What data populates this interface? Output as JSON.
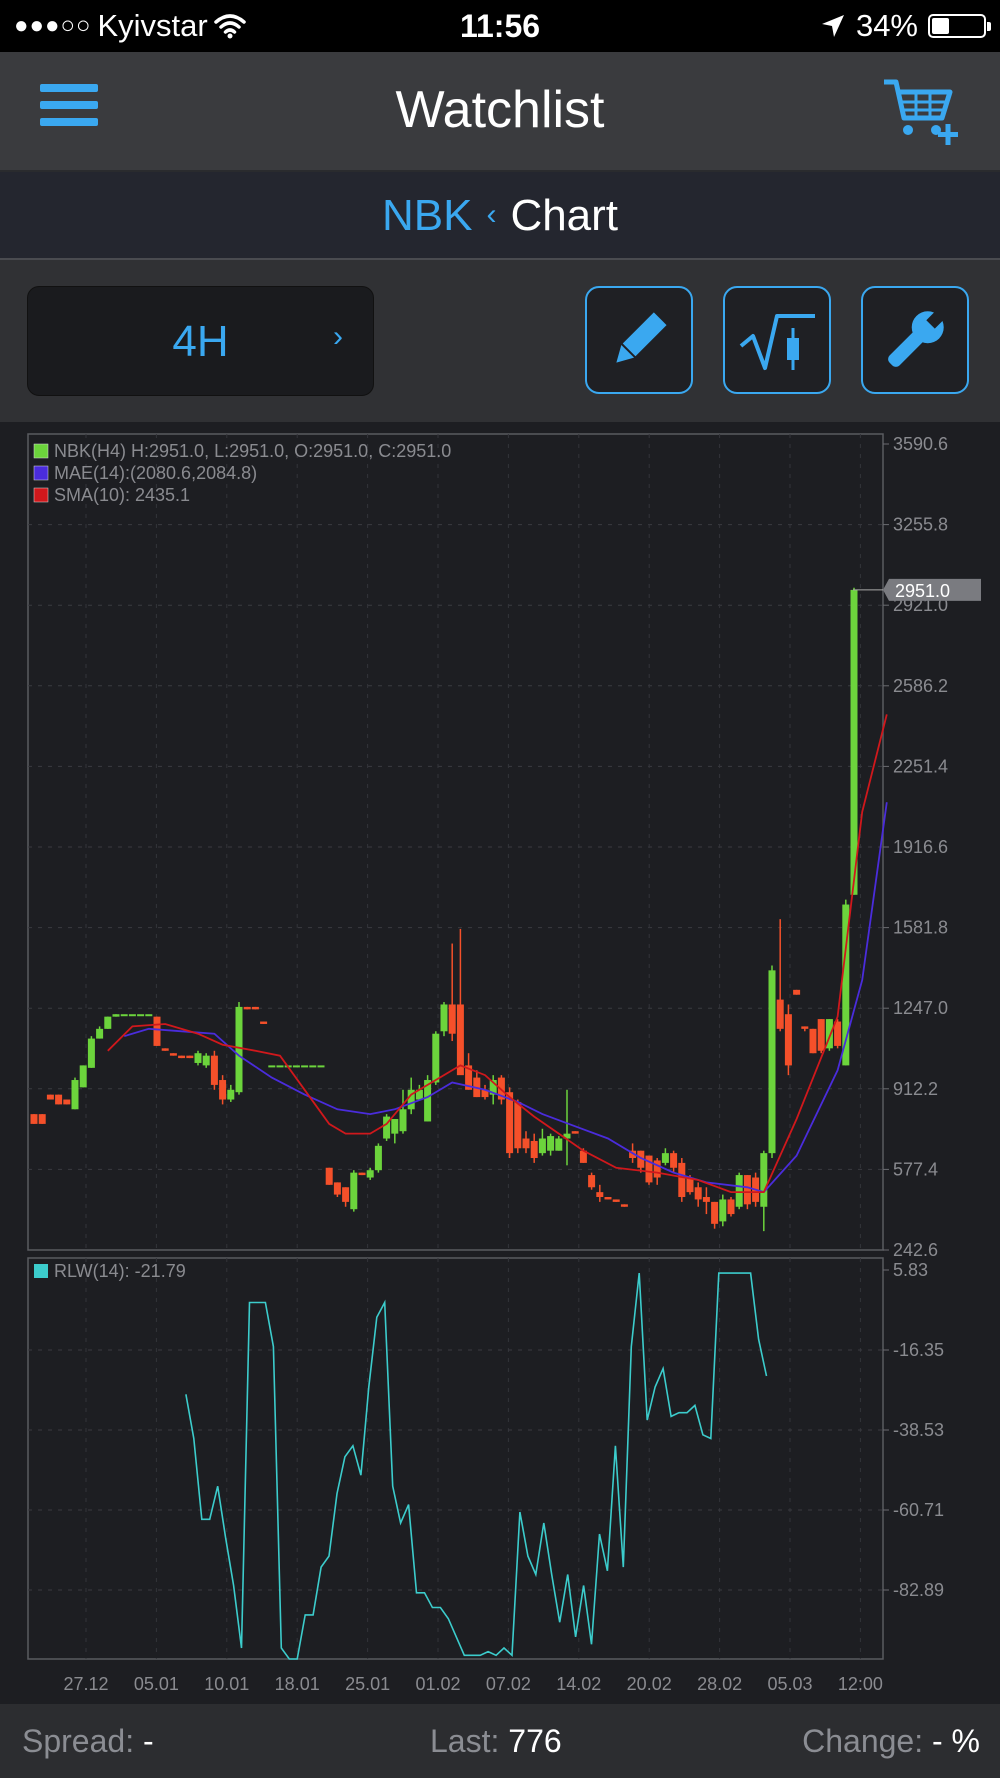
{
  "status_bar": {
    "carrier": "Kyivstar",
    "time": "11:56",
    "battery": "34%",
    "battery_level": 0.34,
    "icons": [
      "signal-dots-icon",
      "wifi-icon",
      "location-arrow-icon",
      "battery-icon"
    ]
  },
  "nav": {
    "title": "Watchlist",
    "left_icon": "hamburger-menu-icon",
    "right_icon": "cart-add-icon"
  },
  "breadcrumb": {
    "parent": "NBK",
    "separator": "‹",
    "current": "Chart"
  },
  "toolbar": {
    "period": "4H",
    "period_chevron": "›",
    "tools": [
      "pencil-icon",
      "indicator-icon",
      "wrench-icon"
    ]
  },
  "colors": {
    "accent": "#3aa8f0",
    "bull": "#6cd43c",
    "bear": "#f4502a",
    "sma": "#d0181c",
    "mae": "#4a2cdc",
    "rlw": "#3ccccc",
    "background": "#1d1e22"
  },
  "chart_data": [
    {
      "type": "candlestick",
      "title": "",
      "legend": [
        {
          "name": "NBK(H4)",
          "text": "NBK(H4) H:2951.0, L:2951.0, O:2951.0, C:2951.0",
          "color": "#6cd43c"
        },
        {
          "name": "MAE(14)",
          "text": "MAE(14):(2080.6,2084.8)",
          "color": "#4a2cdc"
        },
        {
          "name": "SMA(10)",
          "text": "SMA(10): 2435.1",
          "color": "#d0181c"
        }
      ],
      "legend_position": "top-left",
      "y_ticks": [
        "3590.6",
        "3255.8",
        "2921.0",
        "2586.2",
        "2251.4",
        "1916.6",
        "1581.8",
        "1247.0",
        "912.2",
        "577.4",
        "242.6"
      ],
      "ylim": [
        242.6,
        3590.6
      ],
      "last_price_label": "2951.0",
      "last_price": 2951.0,
      "x_ticks": [
        "27.12",
        "05.01",
        "10.01",
        "18.01",
        "25.01",
        "01.02",
        "07.02",
        "14.02",
        "20.02",
        "28.02",
        "05.03",
        "12:00"
      ],
      "grid": true,
      "candles": [
        [
          0,
          800,
          760,
          800,
          760
        ],
        [
          1,
          800,
          760,
          800,
          760
        ],
        [
          2,
          880,
          860,
          880,
          860
        ],
        [
          3,
          880,
          840,
          880,
          840
        ],
        [
          4,
          860,
          840,
          860,
          840
        ],
        [
          5,
          950,
          820,
          820,
          940
        ],
        [
          6,
          1000,
          910,
          910,
          1000
        ],
        [
          7,
          1120,
          990,
          990,
          1110
        ],
        [
          8,
          1160,
          1110,
          1110,
          1150
        ],
        [
          9,
          1200,
          1150,
          1150,
          1200
        ],
        [
          10,
          1210,
          1200,
          1200,
          1210
        ],
        [
          11,
          1210,
          1210,
          1210,
          1210
        ],
        [
          12,
          1210,
          1210,
          1210,
          1210
        ],
        [
          13,
          1210,
          1210,
          1210,
          1210
        ],
        [
          14,
          1210,
          1210,
          1210,
          1210
        ],
        [
          15,
          1200,
          1080,
          1200,
          1080
        ],
        [
          16,
          1070,
          1060,
          1070,
          1060
        ],
        [
          17,
          1050,
          1040,
          1050,
          1040
        ],
        [
          18,
          1040,
          1030,
          1040,
          1030
        ],
        [
          19,
          1040,
          1030,
          1040,
          1030
        ],
        [
          20,
          1060,
          1000,
          1010,
          1050
        ],
        [
          21,
          1050,
          990,
          1000,
          1040
        ],
        [
          22,
          1060,
          900,
          1040,
          920
        ],
        [
          23,
          960,
          840,
          940,
          860
        ],
        [
          24,
          920,
          850,
          860,
          900
        ],
        [
          25,
          1260,
          880,
          890,
          1240
        ],
        [
          26,
          1240,
          1230,
          1240,
          1230
        ],
        [
          27,
          1240,
          1230,
          1240,
          1230
        ],
        [
          28,
          1180,
          1170,
          1180,
          1170
        ],
        [
          29,
          1000,
          1000,
          1000,
          1000
        ],
        [
          30,
          1000,
          1000,
          1000,
          1000
        ],
        [
          31,
          1000,
          1000,
          1000,
          1000
        ],
        [
          32,
          1000,
          1000,
          1000,
          1000
        ],
        [
          33,
          1000,
          1000,
          1000,
          1000
        ],
        [
          34,
          1000,
          1000,
          1000,
          1000
        ],
        [
          35,
          1000,
          1000,
          1000,
          1000
        ],
        [
          36,
          580,
          510,
          580,
          510
        ],
        [
          37,
          520,
          460,
          520,
          470
        ],
        [
          38,
          500,
          420,
          500,
          440
        ],
        [
          39,
          570,
          400,
          410,
          560
        ],
        [
          40,
          560,
          550,
          560,
          550
        ],
        [
          41,
          580,
          530,
          540,
          570
        ],
        [
          42,
          680,
          560,
          570,
          670
        ],
        [
          43,
          800,
          690,
          700,
          790
        ],
        [
          44,
          780,
          680,
          720,
          780
        ],
        [
          45,
          900,
          720,
          730,
          820
        ],
        [
          46,
          950,
          800,
          820,
          900
        ],
        [
          47,
          920,
          860,
          860,
          900
        ],
        [
          48,
          960,
          770,
          770,
          940
        ],
        [
          49,
          1140,
          920,
          930,
          1130
        ],
        [
          50,
          1260,
          1120,
          1140,
          1250
        ],
        [
          51,
          1500,
          1100,
          1250,
          1130
        ],
        [
          52,
          1560,
          1100,
          1250,
          960
        ],
        [
          53,
          1050,
          900,
          1000,
          900
        ],
        [
          54,
          980,
          870,
          950,
          870
        ],
        [
          55,
          920,
          860,
          900,
          870
        ],
        [
          56,
          960,
          840,
          880,
          940
        ],
        [
          57,
          960,
          840,
          950,
          860
        ],
        [
          58,
          910,
          620,
          890,
          640
        ],
        [
          59,
          860,
          640,
          850,
          660
        ],
        [
          60,
          730,
          640,
          700,
          660
        ],
        [
          61,
          720,
          600,
          690,
          620
        ],
        [
          62,
          740,
          630,
          640,
          700
        ],
        [
          63,
          720,
          630,
          650,
          710
        ],
        [
          64,
          710,
          650,
          650,
          700
        ],
        [
          65,
          900,
          590,
          700,
          720
        ],
        [
          66,
          730,
          720,
          730,
          720
        ],
        [
          67,
          660,
          600,
          650,
          600
        ],
        [
          68,
          560,
          490,
          550,
          500
        ],
        [
          69,
          510,
          440,
          480,
          460
        ],
        [
          70,
          460,
          450,
          460,
          450
        ],
        [
          71,
          450,
          440,
          450,
          440
        ],
        [
          72,
          430,
          420,
          430,
          420
        ],
        [
          73,
          680,
          600,
          650,
          620
        ],
        [
          74,
          650,
          560,
          650,
          580
        ],
        [
          75,
          630,
          510,
          630,
          520
        ],
        [
          76,
          620,
          510,
          610,
          540
        ],
        [
          77,
          660,
          590,
          600,
          640
        ],
        [
          78,
          650,
          560,
          640,
          580
        ],
        [
          79,
          620,
          440,
          600,
          460
        ],
        [
          80,
          550,
          470,
          540,
          480
        ],
        [
          81,
          520,
          420,
          500,
          450
        ],
        [
          82,
          500,
          390,
          460,
          440
        ],
        [
          83,
          440,
          330,
          440,
          350
        ],
        [
          84,
          470,
          340,
          360,
          450
        ],
        [
          85,
          460,
          380,
          450,
          390
        ],
        [
          86,
          560,
          410,
          420,
          550
        ],
        [
          87,
          550,
          410,
          550,
          430
        ],
        [
          88,
          560,
          420,
          540,
          440
        ],
        [
          89,
          650,
          320,
          420,
          640
        ],
        [
          90,
          1410,
          620,
          640,
          1390
        ],
        [
          91,
          1600,
          1140,
          1270,
          1150
        ],
        [
          92,
          1250,
          960,
          1210,
          1000
        ],
        [
          93,
          1310,
          1290,
          1310,
          1290
        ],
        [
          94,
          1160,
          1140,
          1160,
          1150
        ],
        [
          95,
          1150,
          1050,
          1150,
          1050
        ],
        [
          96,
          1190,
          1050,
          1190,
          1060
        ],
        [
          97,
          1190,
          1060,
          1070,
          1190
        ],
        [
          98,
          1190,
          1070,
          1180,
          1080
        ],
        [
          99,
          1680,
          1000,
          1000,
          1660
        ],
        [
          100,
          2960,
          1700,
          1700,
          2951.0
        ]
      ],
      "sma_10": [
        [
          9,
          1060
        ],
        [
          12,
          1160
        ],
        [
          16,
          1170
        ],
        [
          20,
          1130
        ],
        [
          23,
          1085
        ],
        [
          27,
          1060
        ],
        [
          30,
          1040
        ],
        [
          33,
          900
        ],
        [
          36,
          760
        ],
        [
          38,
          720
        ],
        [
          41,
          720
        ],
        [
          43,
          760
        ],
        [
          46,
          880
        ],
        [
          49,
          940
        ],
        [
          52,
          1000
        ],
        [
          55,
          960
        ],
        [
          58,
          870
        ],
        [
          61,
          790
        ],
        [
          64,
          720
        ],
        [
          67,
          650
        ],
        [
          71,
          580
        ],
        [
          76,
          560
        ],
        [
          81,
          530
        ],
        [
          85,
          480
        ],
        [
          89,
          480
        ],
        [
          93,
          780
        ],
        [
          98,
          1200
        ],
        [
          101,
          2040
        ],
        [
          104,
          2440
        ]
      ],
      "mae_14": [
        [
          11,
          1120
        ],
        [
          14,
          1150
        ],
        [
          18,
          1140
        ],
        [
          22,
          1130
        ],
        [
          25,
          1040
        ],
        [
          29,
          950
        ],
        [
          33,
          880
        ],
        [
          37,
          820
        ],
        [
          41,
          800
        ],
        [
          44,
          820
        ],
        [
          48,
          870
        ],
        [
          51,
          930
        ],
        [
          55,
          900
        ],
        [
          59,
          850
        ],
        [
          62,
          800
        ],
        [
          66,
          750
        ],
        [
          70,
          700
        ],
        [
          74,
          620
        ],
        [
          78,
          560
        ],
        [
          82,
          520
        ],
        [
          87,
          500
        ],
        [
          89,
          480
        ],
        [
          93,
          630
        ],
        [
          98,
          980
        ],
        [
          101,
          1350
        ],
        [
          104,
          2080
        ]
      ]
    },
    {
      "type": "line",
      "title": "",
      "legend": [
        {
          "name": "RLW(14)",
          "text": "RLW(14): -21.79",
          "color": "#3ccccc"
        }
      ],
      "y_ticks": [
        "5.83",
        "-16.35",
        "-38.53",
        "-60.71",
        "-82.89"
      ],
      "ylim": [
        -100,
        5.83
      ],
      "grid": true,
      "series": [
        {
          "name": "RLW(14)",
          "values": [
            [
              16,
              -28
            ],
            [
              17,
              -40
            ],
            [
              18,
              -62
            ],
            [
              19,
              -62
            ],
            [
              20,
              -53
            ],
            [
              21,
              -67
            ],
            [
              22,
              -80
            ],
            [
              23,
              -97
            ],
            [
              24,
              -3
            ],
            [
              25,
              -3
            ],
            [
              26,
              -3
            ],
            [
              27,
              -15
            ],
            [
              28,
              -97
            ],
            [
              29,
              -100
            ],
            [
              30,
              -100
            ],
            [
              31,
              -88
            ],
            [
              32,
              -88
            ],
            [
              33,
              -75
            ],
            [
              34,
              -72
            ],
            [
              35,
              -55
            ],
            [
              36,
              -45
            ],
            [
              37,
              -42
            ],
            [
              38,
              -50
            ],
            [
              39,
              -26
            ],
            [
              40,
              -7
            ],
            [
              41,
              -3
            ],
            [
              42,
              -53
            ],
            [
              43,
              -63
            ],
            [
              44,
              -58
            ],
            [
              45,
              -82
            ],
            [
              46,
              -82
            ],
            [
              47,
              -86
            ],
            [
              48,
              -86
            ],
            [
              49,
              -89
            ],
            [
              50,
              -94
            ],
            [
              51,
              -99
            ],
            [
              52,
              -99
            ],
            [
              53,
              -99
            ],
            [
              54,
              -98
            ],
            [
              55,
              -99
            ],
            [
              56,
              -97
            ],
            [
              57,
              -99
            ],
            [
              58,
              -60
            ],
            [
              59,
              -72
            ],
            [
              60,
              -77
            ],
            [
              61,
              -63
            ],
            [
              62,
              -77
            ],
            [
              63,
              -90
            ],
            [
              64,
              -77
            ],
            [
              65,
              -94
            ],
            [
              66,
              -80
            ],
            [
              67,
              -96
            ],
            [
              68,
              -66
            ],
            [
              69,
              -76
            ],
            [
              70,
              -42
            ],
            [
              71,
              -75
            ],
            [
              72,
              -15
            ],
            [
              73,
              5
            ],
            [
              74,
              -35
            ],
            [
              75,
              -26
            ],
            [
              76,
              -21
            ],
            [
              77,
              -34
            ],
            [
              78,
              -33
            ],
            [
              79,
              -33
            ],
            [
              80,
              -31
            ],
            [
              81,
              -39
            ],
            [
              82,
              -40
            ],
            [
              83,
              5
            ],
            [
              84,
              5
            ],
            [
              85,
              5
            ],
            [
              86,
              5
            ],
            [
              87,
              5
            ],
            [
              88,
              -13
            ],
            [
              89,
              -23
            ]
          ]
        }
      ]
    }
  ],
  "footer": {
    "spread_label": "Spread:",
    "spread_value": "-",
    "last_label": "Last:",
    "last_value": "776",
    "change_label": "Change:",
    "change_value": "- %"
  }
}
